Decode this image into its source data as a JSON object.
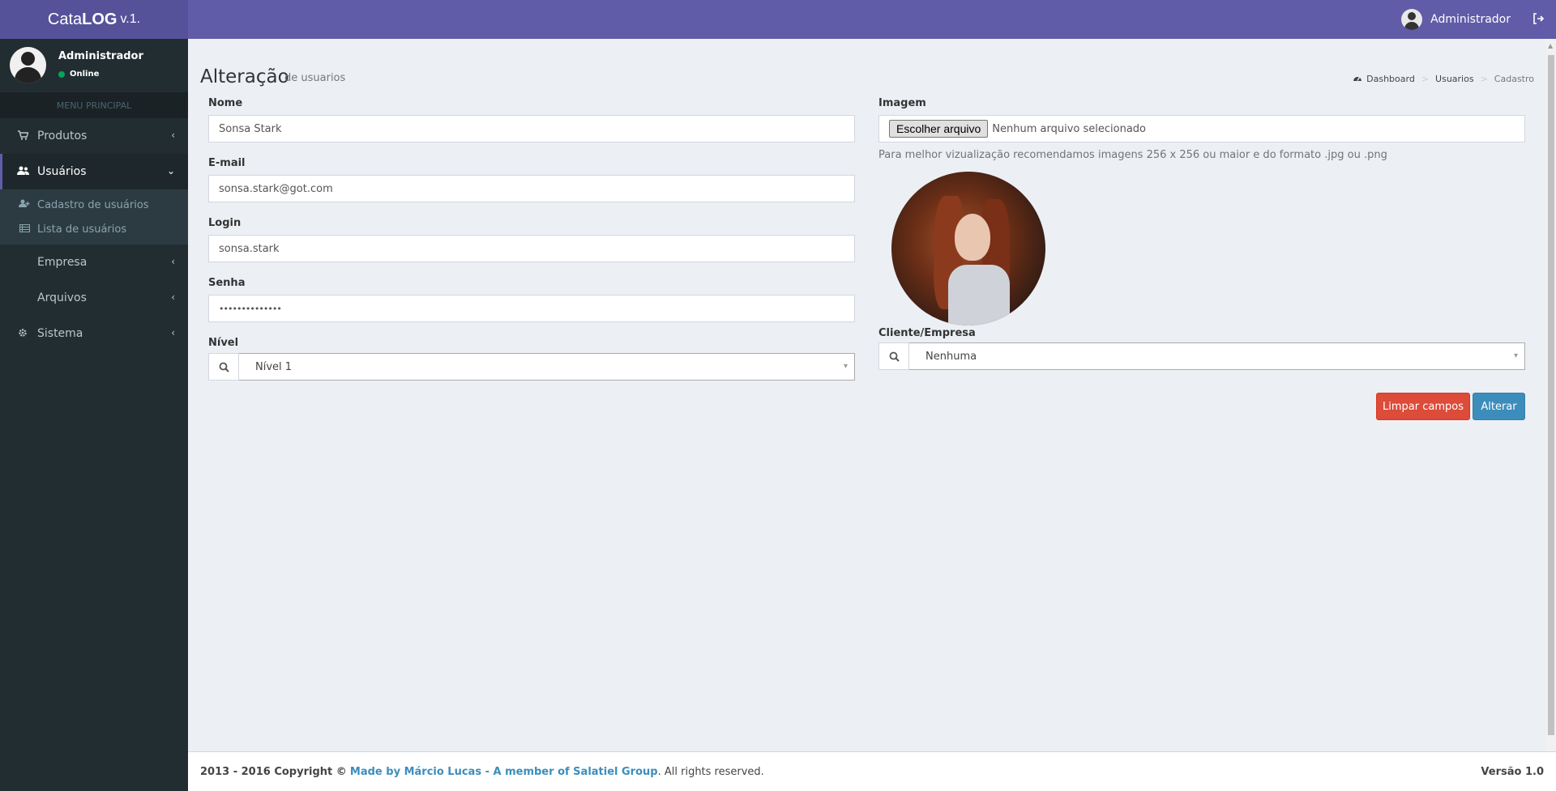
{
  "brand": {
    "name_light": "Cata",
    "name_bold": "LOG",
    "version": "v.1."
  },
  "header": {
    "user": "Administrador"
  },
  "sidebar": {
    "user_name": "Administrador",
    "status": "Online",
    "menu_header": "MENU PRINCIPAL",
    "items": [
      {
        "label": "Produtos",
        "icon": "cart-icon"
      },
      {
        "label": "Usuários",
        "icon": "users-icon"
      },
      {
        "label": "Empresa",
        "icon": ""
      },
      {
        "label": "Arquivos",
        "icon": ""
      },
      {
        "label": "Sistema",
        "icon": "gear-icon"
      }
    ],
    "subitems": [
      {
        "label": "Cadastro de usuários",
        "icon": "user-plus-icon"
      },
      {
        "label": "Lista de usuários",
        "icon": "list-icon"
      }
    ]
  },
  "page": {
    "title": "Alteração",
    "subtitle": "de usuarios"
  },
  "breadcrumb": {
    "home": "Dashboard",
    "section": "Usuarios",
    "current": "Cadastro"
  },
  "form": {
    "nome_label": "Nome",
    "nome_value": "Sonsa Stark",
    "email_label": "E-mail",
    "email_value": "sonsa.stark@got.com",
    "login_label": "Login",
    "login_value": "sonsa.stark",
    "senha_label": "Senha",
    "senha_value": "••••••••••••••",
    "nivel_label": "Nível",
    "nivel_value": "Nível 1",
    "imagem_label": "Imagem",
    "file_button": "Escolher arquivo",
    "file_status": "Nenhum arquivo selecionado",
    "imagem_help": "Para melhor vizualização recomendamos imagens 256 x 256 ou maior e do formato .jpg ou .png",
    "cliente_label": "Cliente/Empresa",
    "cliente_value": "Nenhuma",
    "clear_button": "Limpar campos",
    "submit_button": "Alterar"
  },
  "footer": {
    "copyright": "2013 - 2016 Copyright ©",
    "link": "Made by Márcio Lucas - A member of Salatiel Group",
    "rights": ". All rights reserved.",
    "version": "Versão 1.0"
  },
  "colors": {
    "header": "#605ca8",
    "logo_bg": "#555299",
    "sidebar": "#222d32",
    "danger": "#dd4b39",
    "primary": "#3c8dbc"
  }
}
